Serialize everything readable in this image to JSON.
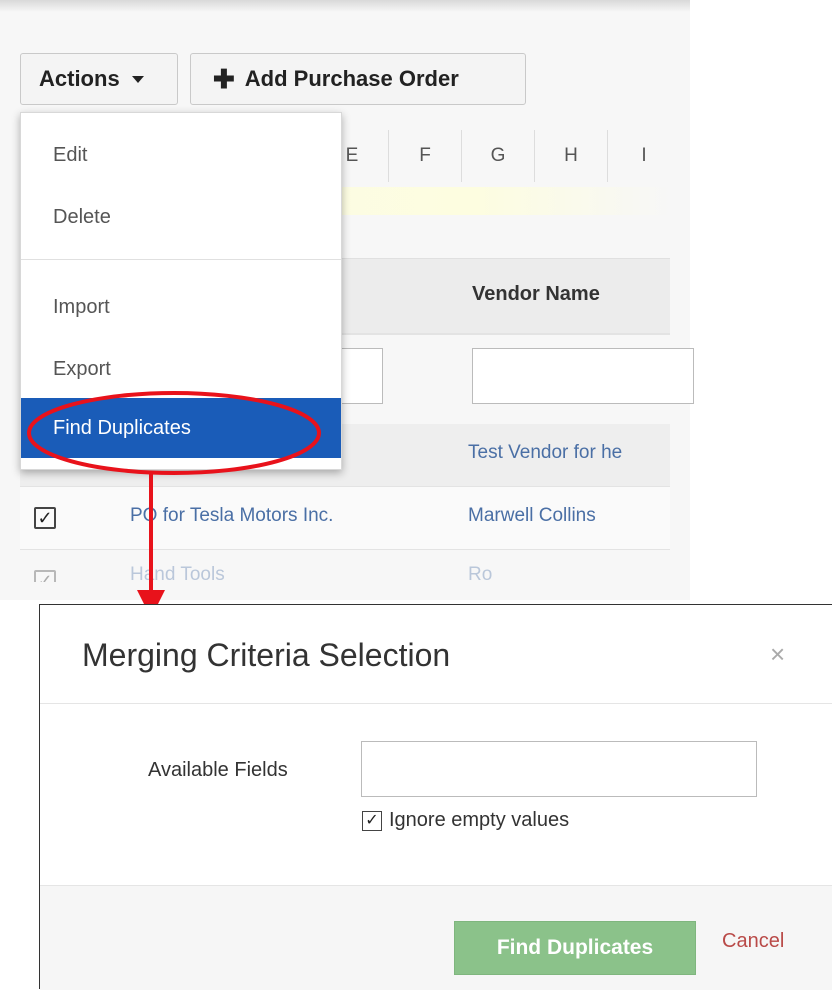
{
  "toolbar": {
    "actions_label": "Actions",
    "add_po_label": "Add Purchase Order"
  },
  "alphabet_filter": [
    "E",
    "F",
    "G",
    "H",
    "I"
  ],
  "table": {
    "vendor_header": "Vendor Name",
    "rows": [
      {
        "subject": "",
        "vendor": "Test Vendor for he",
        "checked": false
      },
      {
        "subject": "PO for Tesla Motors Inc.",
        "vendor": "Marwell Collins",
        "checked": true
      },
      {
        "subject": "Hand Tools",
        "vendor": "Ro",
        "checked": true
      }
    ]
  },
  "actions_menu": {
    "items": [
      "Edit",
      "Delete",
      "Import",
      "Export",
      "Find Duplicates"
    ],
    "highlighted": "Find Duplicates"
  },
  "annotation": {
    "color": "#e8121b",
    "target": "Find Duplicates"
  },
  "dialog": {
    "title": "Merging Criteria Selection",
    "close_symbol": "×",
    "available_fields_label": "Available Fields",
    "available_fields_value": "",
    "ignore_empty_label": "Ignore empty values",
    "ignore_empty_checked": true,
    "find_button_label": "Find Duplicates",
    "cancel_label": "Cancel"
  },
  "colors": {
    "menu_highlight": "#1a5cb8",
    "find_button": "#8bc28a",
    "cancel_link": "#b94a48",
    "link": "#4a6fa5"
  }
}
